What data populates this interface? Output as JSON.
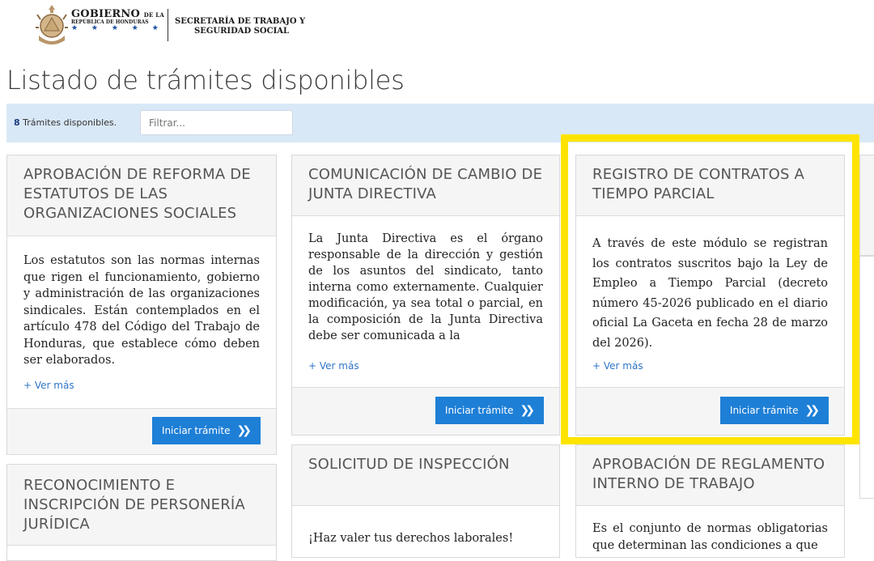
{
  "header": {
    "gob_title": "GOBIERNO",
    "gob_title_small": "DE LA",
    "gob_subtitle": "REPÚBLICA DE HONDURAS",
    "stars": "★ ★ ★ ★ ★",
    "secretaria_line1": "SECRETARÍA DE TRABAJO Y",
    "secretaria_line2": "SEGURIDAD SOCIAL"
  },
  "page_title": "Listado de trámites disponibles",
  "filter": {
    "count": "8",
    "count_label": " Trámites disponibles.",
    "placeholder": "Filtrar..."
  },
  "cards": [
    {
      "title": "APROBACIÓN DE REFORMA DE ESTATUTOS DE LAS ORGANIZACIONES SOCIALES",
      "body": "Los estatutos son las normas internas que rigen el funcionamiento, gobierno y administración de las organizaciones sindicales. Están contemplados en el artículo 478 del Código del Trabajo de Honduras, que establece cómo deben ser elaborados.",
      "more": "+ Ver más",
      "button": "Iniciar trámite"
    },
    {
      "title": "COMUNICACIÓN DE CAMBIO DE JUNTA DIRECTIVA",
      "body": "La Junta Directiva es el órgano responsable de la dirección y gestión de los asuntos del sindicato, tanto interna como externamente. Cualquier modificación, ya sea total o parcial, en la composición de la Junta Directiva debe ser comunicada a la",
      "more": "+ Ver más",
      "button": "Iniciar trámite"
    },
    {
      "title": "REGISTRO DE CONTRATOS A TIEMPO PARCIAL",
      "body": "A través de este módulo se registran los contratos suscritos bajo la Ley de Empleo a Tiempo Parcial (decreto número 45-2026 publicado en el diario oficial La Gaceta en fecha 28 de marzo del 2026).",
      "more": "+ Ver más",
      "button": "Iniciar trámite"
    },
    {
      "title": "RECONOCIMIENTO E INSCRIPCIÓN DE PERSONERÍA JURÍDICA"
    },
    {
      "title": "SOLICITUD DE INSPECCIÓN",
      "body": "¡Haz valer tus derechos laborales!"
    },
    {
      "title": "APROBACIÓN DE REGLAMENTO INTERNO DE TRABAJO",
      "body": "Es el conjunto de normas obligatorias que determinan las condiciones a que"
    }
  ],
  "colors": {
    "accent": "#1e7fd6",
    "highlight": "#ffe400",
    "filter_bg": "#d9e8f7"
  },
  "icons": {
    "button_icon": "double-chevron-right-icon"
  }
}
